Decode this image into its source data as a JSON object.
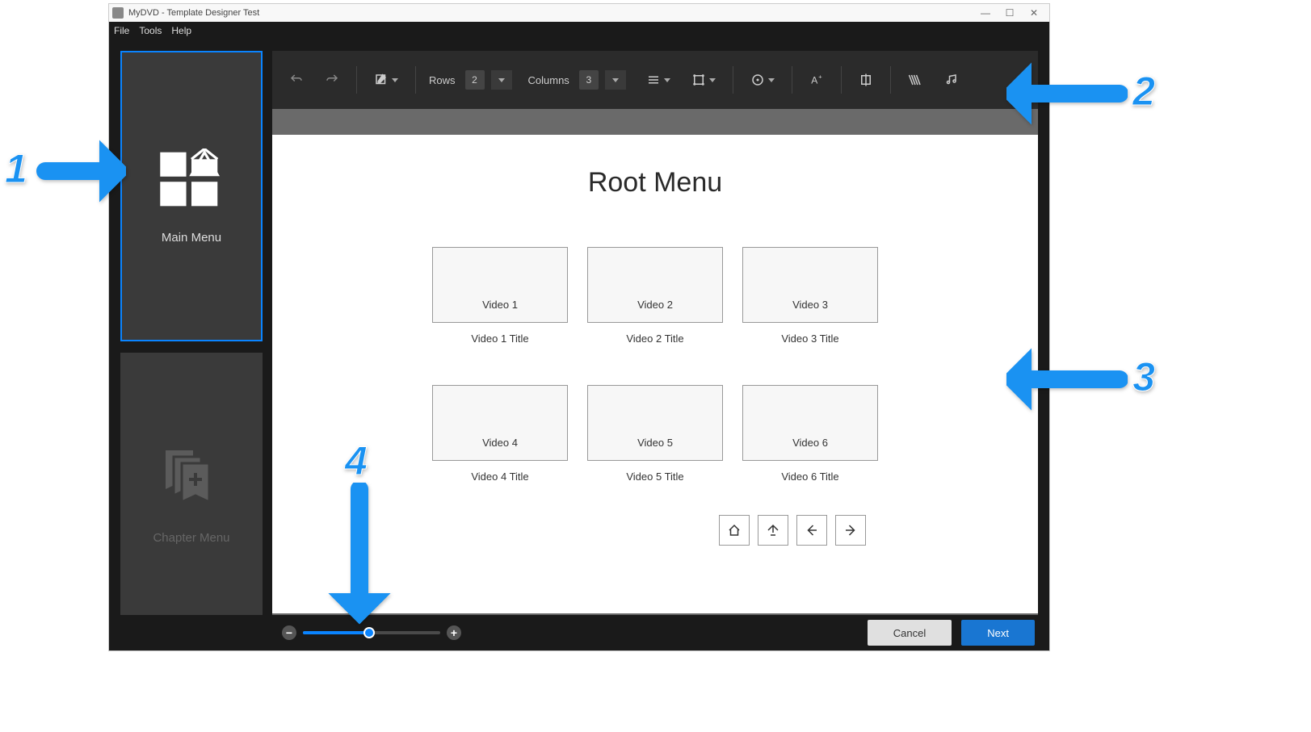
{
  "window": {
    "title": "MyDVD - Template Designer Test"
  },
  "menubar": {
    "file": "File",
    "tools": "Tools",
    "help": "Help"
  },
  "sidebar": {
    "main_menu": "Main Menu",
    "chapter_menu": "Chapter Menu"
  },
  "toolbar": {
    "rows_label": "Rows",
    "rows_value": "2",
    "columns_label": "Columns",
    "columns_value": "3"
  },
  "canvas": {
    "title": "Root Menu",
    "videos": [
      {
        "thumb": "Video 1",
        "title": "Video 1 Title"
      },
      {
        "thumb": "Video 2",
        "title": "Video 2 Title"
      },
      {
        "thumb": "Video 3",
        "title": "Video 3 Title"
      },
      {
        "thumb": "Video 4",
        "title": "Video 4 Title"
      },
      {
        "thumb": "Video 5",
        "title": "Video 5 Title"
      },
      {
        "thumb": "Video 6",
        "title": "Video 6 Title"
      }
    ]
  },
  "zoom": {
    "percent": 48
  },
  "footer": {
    "cancel": "Cancel",
    "next": "Next"
  },
  "annotations": {
    "n1": "1",
    "n2": "2",
    "n3": "3",
    "n4": "4"
  }
}
